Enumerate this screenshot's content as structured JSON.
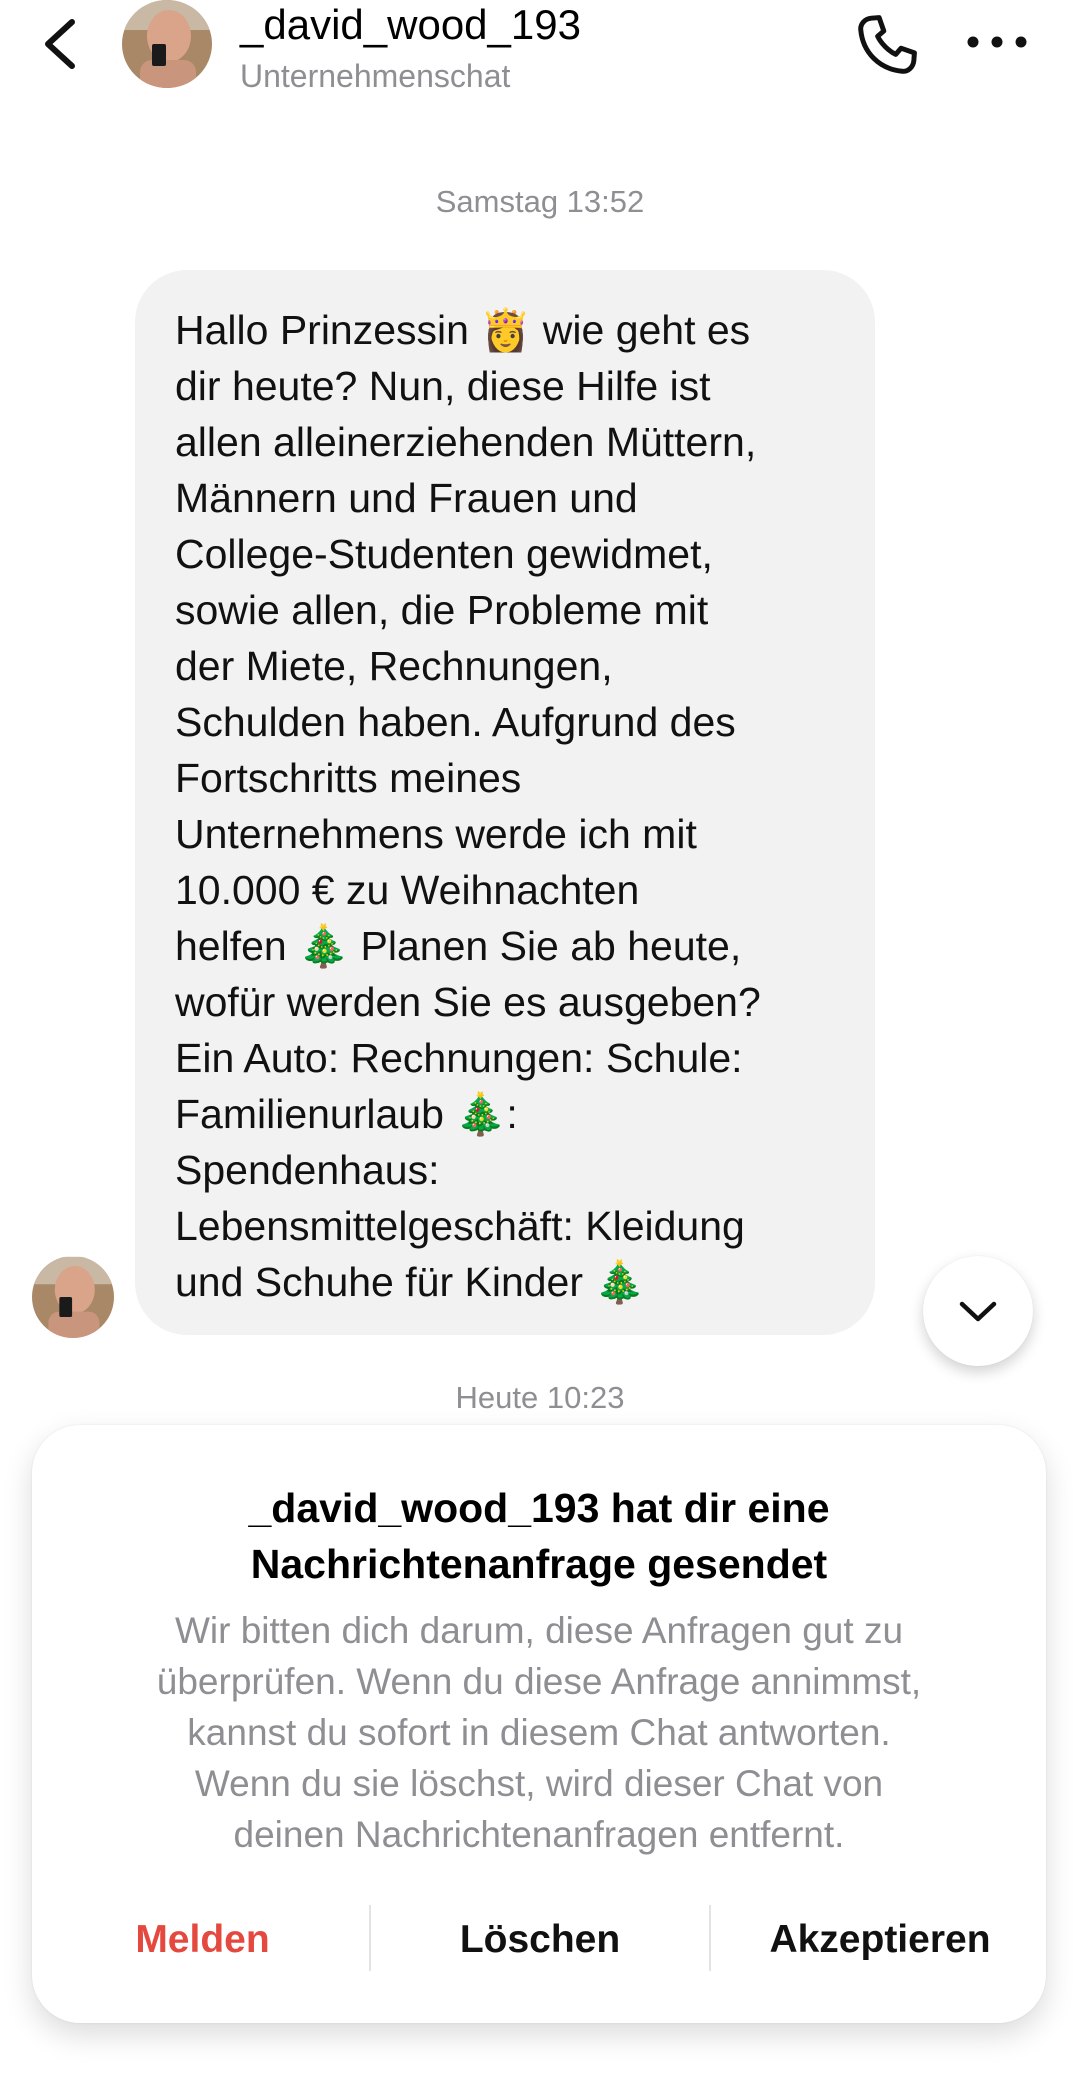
{
  "header": {
    "username": "_david_wood_193",
    "subtitle": "Unternehmenschat",
    "back_icon": "chevron-left-icon",
    "call_icon": "phone-icon",
    "more_icon": "more-horizontal-icon"
  },
  "chat": {
    "timestamp_1": "Samstag 13:52",
    "message_1": "Hallo Prinzessin 👸 wie geht es\ndir heute? Nun, diese Hilfe ist\nallen alleinerziehenden Müttern,\nMännern und Frauen und\nCollege-Studenten gewidmet,\nsowie allen, die Probleme mit\nder Miete, Rechnungen,\nSchulden haben. Aufgrund des\nFortschritts meines\nUnternehmens werde ich mit\n10.000 € zu Weihnachten\nhelfen 🎄 Planen Sie ab heute,\nwofür werden Sie es ausgeben?\nEin Auto: Rechnungen: Schule:\nFamilienurlaub 🎄:\nSpendenhaus:\nLebensmittelgeschäft: Kleidung\nund Schuhe für Kinder 🎄",
    "timestamp_2": "Heute 10:23"
  },
  "request_card": {
    "title_line1": "_david_wood_193 hat dir eine",
    "title_line2": "Nachrichtenanfrage gesendet",
    "body_lines": [
      "Wir bitten dich darum, diese Anfragen gut zu",
      "überprüfen. Wenn du diese Anfrage annimmst,",
      "kannst du sofort in diesem Chat antworten.",
      "Wenn du sie löschst, wird dieser Chat von",
      "deinen Nachrichtenanfragen entfernt."
    ],
    "report_label": "Melden",
    "delete_label": "Löschen",
    "accept_label": "Akzeptieren"
  },
  "colors": {
    "report": "#e5483e",
    "bubble": "#f2f2f3",
    "muted_text": "#8e8e93"
  }
}
